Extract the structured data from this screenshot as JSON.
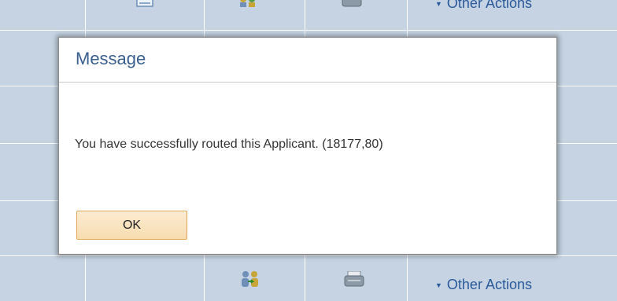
{
  "dialog": {
    "title": "Message",
    "message": "You have successfully routed this Applicant. (18177,80)",
    "ok_label": "OK"
  },
  "background_rows": [
    {
      "other_actions_label": "Other Actions"
    },
    {
      "other_actions_label": "Other Actions"
    }
  ],
  "icons": {
    "notes": "notes-icon",
    "people": "people-route-icon",
    "print": "printer-icon",
    "caret": "caret-down-icon"
  },
  "colors": {
    "grid_bg": "#c5d3e2",
    "link": "#2a5a9b",
    "title": "#3a5f8f",
    "ok_bg": "#f8dcb0",
    "ok_border": "#e0a75a"
  }
}
